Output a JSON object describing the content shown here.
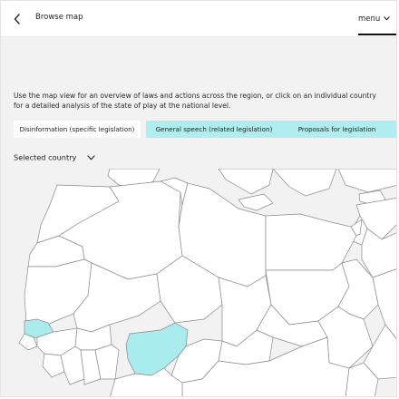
{
  "header": {
    "back_icon": "chevron-left-icon",
    "title": "Browse map",
    "menu_label": "menu",
    "menu_icon": "chevron-down-icon"
  },
  "intro": {
    "text": "Use the map view for an overview of laws and actions across the region, or click on an individual country for a detailed analysis of the state of play at the national level."
  },
  "filters": [
    {
      "label": "Disinformation (specific legislation)",
      "selected": false
    },
    {
      "label": "General speech (related legislation)",
      "selected": true
    },
    {
      "label": "Proposals for legislation",
      "selected": true
    }
  ],
  "selector": {
    "label": "Selected country",
    "icon": "chevron-down-icon"
  },
  "map": {
    "highlight_color": "#a8ecee",
    "highlighted_countries": [
      "Senegal",
      "Nigeria"
    ]
  }
}
